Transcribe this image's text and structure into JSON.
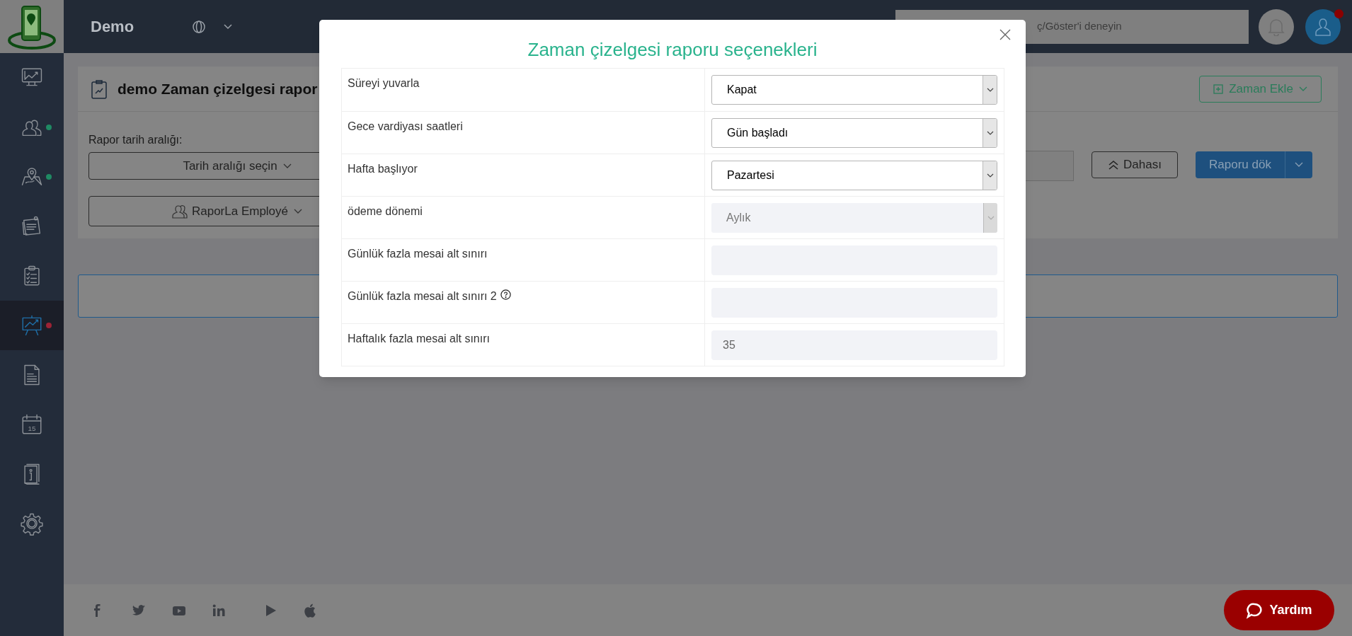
{
  "header": {
    "brand": "Demo",
    "search": {
      "placeholder": "ç/Göster'i deneyin"
    },
    "notification": true
  },
  "sidebar": {
    "items": [
      {
        "kind": "monitor-chart",
        "selected": false
      },
      {
        "kind": "users",
        "selected": false,
        "color": "#1f8a63"
      },
      {
        "kind": "map",
        "selected": false,
        "color": "#1f8a63"
      },
      {
        "kind": "notes",
        "selected": false
      },
      {
        "kind": "checklist",
        "selected": false
      },
      {
        "kind": "presentation",
        "selected": true,
        "color": "#9b2335"
      },
      {
        "kind": "document",
        "selected": false
      },
      {
        "kind": "calendar",
        "selected": false,
        "day": "15"
      },
      {
        "kind": "book",
        "selected": false
      },
      {
        "kind": "gear",
        "selected": false
      }
    ]
  },
  "page": {
    "title": "demo Zaman çizelgesi rapor",
    "add_button": "Zaman Ekle",
    "date_label": "Rapor tarih aralığı:",
    "date_button": "Tarih aralığı seçin",
    "employee_button": "RaporLa Employé",
    "more_button": "Dahası",
    "run_button": "Raporu dök"
  },
  "modal": {
    "title": "Zaman çizelgesi raporu seçenekleri",
    "rows": [
      {
        "kind": "select",
        "label": "Süreyi yuvarla",
        "value": "Kapat",
        "disabled": false
      },
      {
        "kind": "select",
        "label": "Gece vardiyası saatleri",
        "value": "Gün başladı",
        "disabled": false
      },
      {
        "kind": "select",
        "label": "Hafta başlıyor",
        "value": "Pazartesi",
        "disabled": false
      },
      {
        "kind": "select",
        "label": "ödeme dönemi",
        "value": "Aylık",
        "disabled": true
      },
      {
        "kind": "input",
        "label": "Günlük fazla mesai alt sınırı",
        "disabled": true
      },
      {
        "kind": "input",
        "label": "Günlük fazla mesai alt sınırı 2",
        "help": true,
        "disabled": true
      },
      {
        "kind": "input",
        "label": "Haftalık fazla mesai alt sınırı",
        "value": "35",
        "disabled": true
      }
    ]
  },
  "footer": {
    "icons": [
      {
        "kind": "facebook"
      },
      {
        "kind": "twitter"
      },
      {
        "kind": "youtube"
      },
      {
        "kind": "linkedin"
      },
      {
        "kind": "play"
      },
      {
        "kind": "apple"
      }
    ],
    "help_button": "Yardım"
  }
}
